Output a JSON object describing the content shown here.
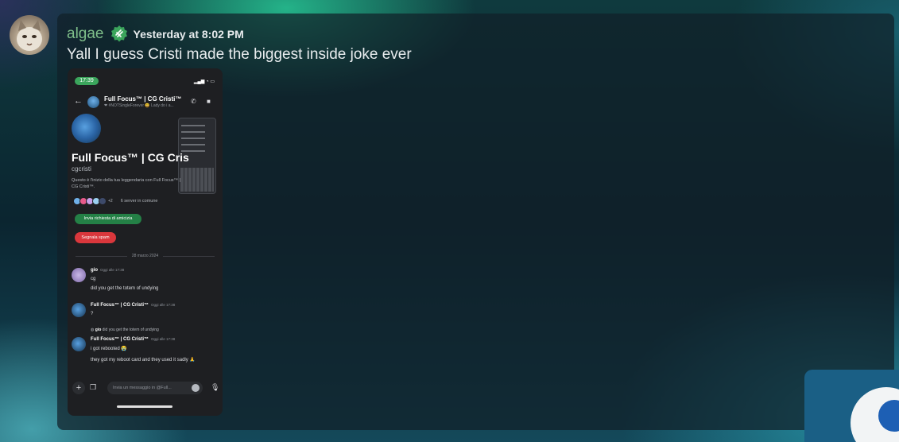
{
  "message": {
    "username": "algae",
    "timestamp": "Yesterday at 8:02 PM",
    "text": "Yall I guess Cristi made the biggest inside joke ever"
  },
  "screenshot": {
    "status_time": "17:39",
    "top_name": "Full Focus™ | CG Cristi™",
    "top_sub": "❤ #NOTSingleForever 😄 Lady do i a...",
    "profile_name": "Full Focus™ | CG Cris",
    "handle": "cgcristi",
    "description": "Questo è l'inizio della tua leggendaria con Full Focus™ | CG Cristi™.",
    "mutual_extra": "+2",
    "mutual_text": "6 server in comune",
    "friend_button": "Invia richiesta di amicizia",
    "spam_button": "Segnala spam",
    "date_divider": "28 marzo 2024",
    "messages": [
      {
        "author": "gio",
        "time": "Oggi alle 17:38",
        "lines": [
          "cg",
          "did you get the totem of undying"
        ]
      },
      {
        "author": "Full Focus™ | CG Cristi™",
        "time": "Oggi alle 17:38",
        "lines": [
          "?"
        ]
      },
      {
        "author": "Full Focus™ | CG Cristi™",
        "time": "Oggi alle 17:38",
        "lines": [
          "i got rebooted 😭",
          "they got my reboot card and they used it sadly 🙏"
        ]
      }
    ],
    "reply_author": "gio",
    "reply_text": "did you get the totem of undying",
    "input_placeholder": "Invia un messaggio in @Full..."
  },
  "icons": {
    "badge": "verified-badge-icon",
    "back": "arrow-left-icon",
    "call": "phone-icon",
    "video": "video-icon",
    "plus": "plus-icon",
    "gift": "gift-icon",
    "emoji": "emoji-icon",
    "mic": "microphone-icon"
  },
  "colors": {
    "username": "#7fbf8a",
    "friend_button": "#248046",
    "spam_button": "#da373c",
    "status_pill": "#3ba55c"
  }
}
